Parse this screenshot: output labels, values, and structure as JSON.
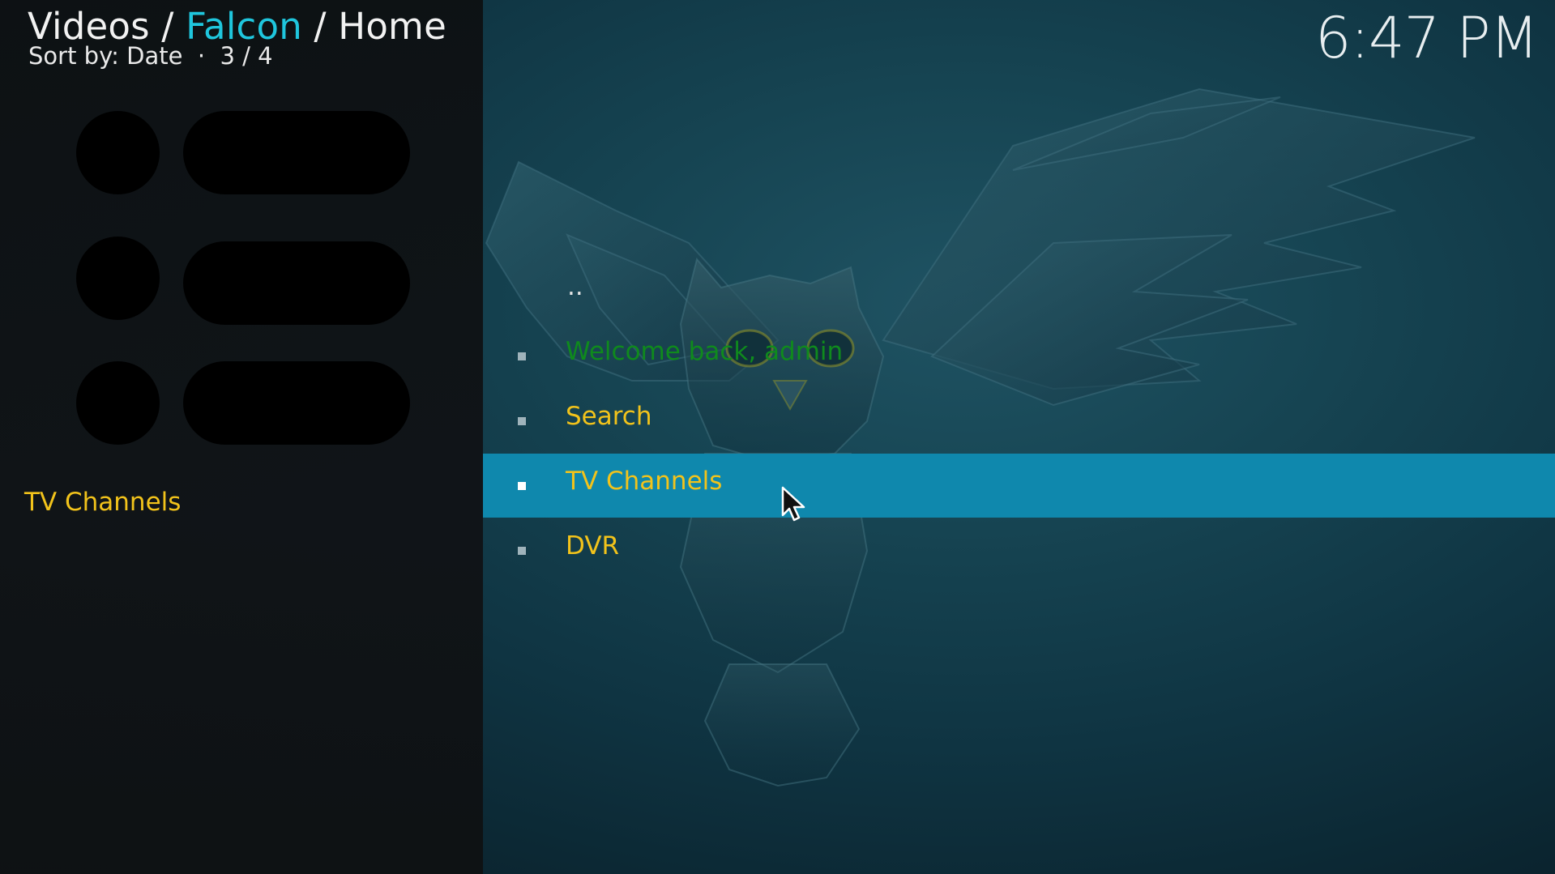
{
  "header": {
    "breadcrumb_prefix": "Videos / ",
    "breadcrumb_addon": "Falcon",
    "breadcrumb_suffix": " / Home",
    "sort_text": "Sort by: Date  ·  3 / 4",
    "clock": "6:47 PM"
  },
  "side_panel": {
    "selected_label": "TV Channels"
  },
  "list": {
    "items": [
      {
        "label": ".."
      },
      {
        "label": "Welcome back, admin"
      },
      {
        "label": "Search"
      },
      {
        "label": "TV Channels"
      },
      {
        "label": "DVR"
      }
    ],
    "selected_index": 3
  },
  "colors": {
    "accent": "#1fc6dd",
    "item_text": "#f2c31b",
    "greeting_text": "#0f8a1d",
    "selection_bar": "#0f88ad"
  }
}
